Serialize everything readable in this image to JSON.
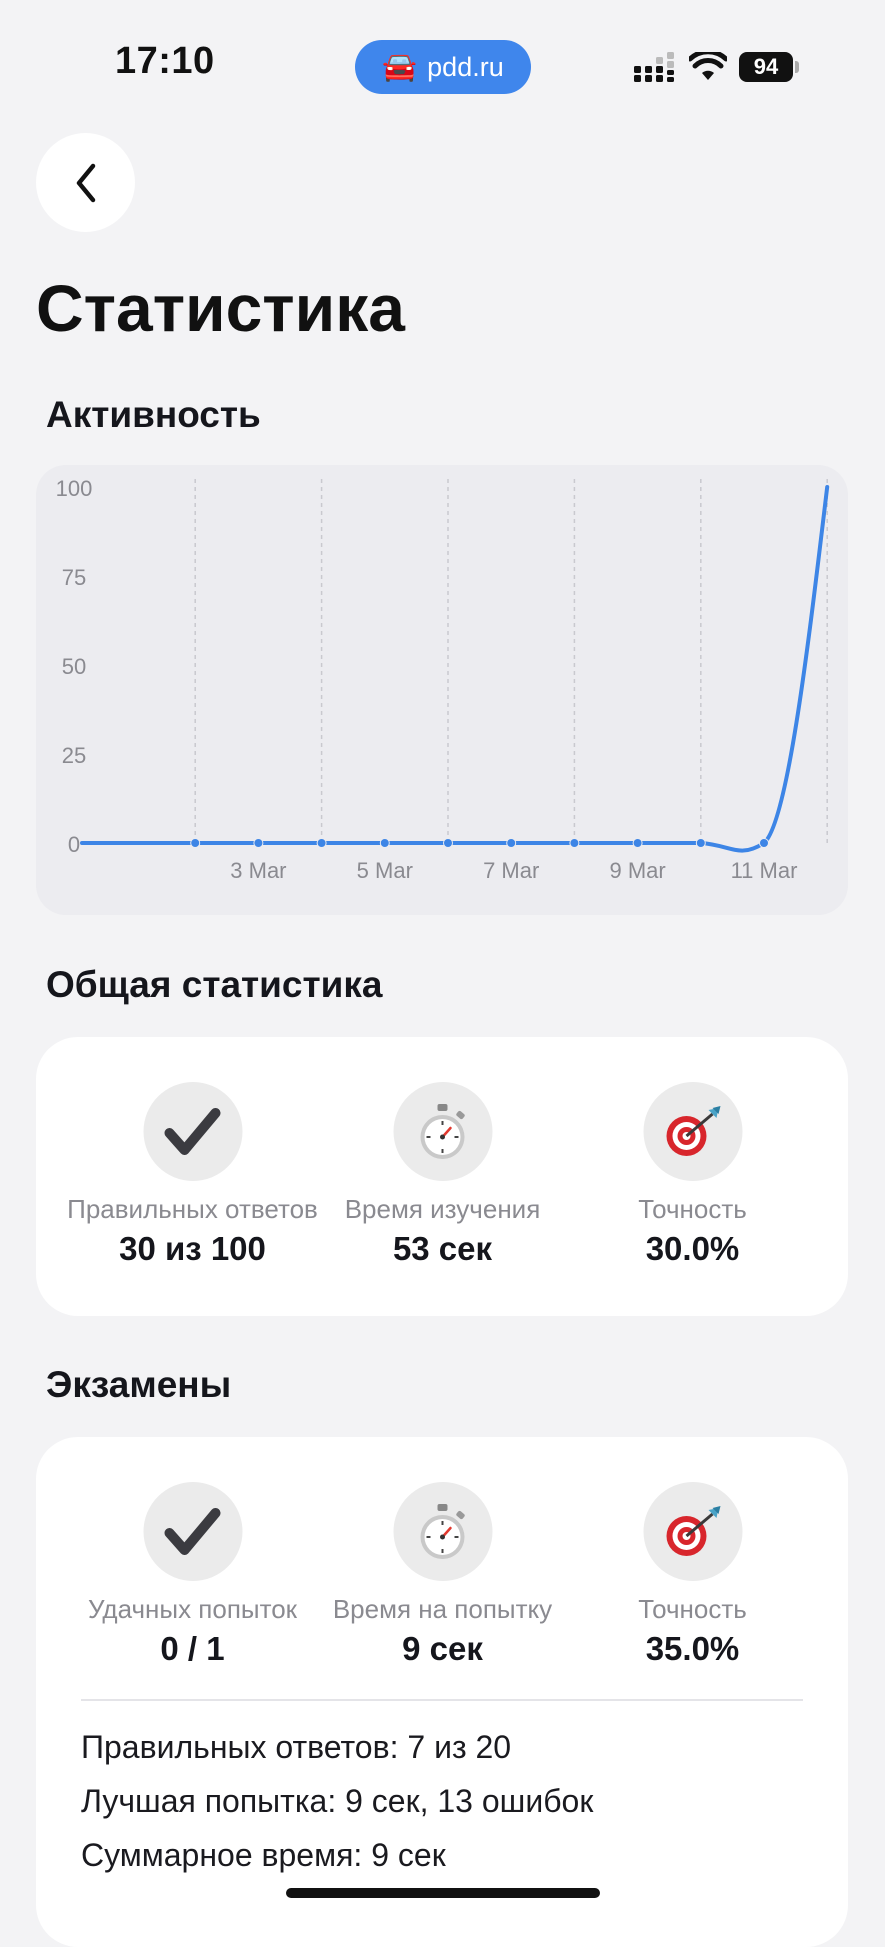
{
  "status_bar": {
    "time": "17:10",
    "url": "pdd.ru",
    "url_icon": "car-icon",
    "battery": "94"
  },
  "page": {
    "title": "Статистика"
  },
  "activity": {
    "title": "Активность",
    "chart_data": {
      "type": "line",
      "title": "",
      "xlabel": "",
      "ylabel": "",
      "y_ticks": [
        "100",
        "75",
        "50",
        "25",
        "0"
      ],
      "x_tick_labels": [
        "3 Mar",
        "5 Mar",
        "7 Mar",
        "9 Mar",
        "11 Mar"
      ],
      "ylim": [
        0,
        100
      ],
      "grid": "vertical dashed",
      "legend": "none",
      "color": "#3d85e6",
      "series": [
        {
          "x": [
            "1 Mar",
            "2 Mar",
            "3 Mar",
            "4 Mar",
            "5 Mar",
            "6 Mar",
            "7 Mar",
            "8 Mar",
            "9 Mar",
            "10 Mar",
            "11 Mar",
            "12 Mar"
          ],
          "values": [
            0,
            0,
            0,
            0,
            0,
            0,
            0,
            0,
            0,
            0,
            0,
            100
          ]
        }
      ]
    }
  },
  "general": {
    "title": "Общая статистика",
    "items": [
      {
        "icon": "checkmark-icon",
        "label": "Правильных ответов",
        "value": "30 из 100"
      },
      {
        "icon": "stopwatch-icon",
        "label": "Время изучения",
        "value": "53 сек"
      },
      {
        "icon": "target-icon",
        "label": "Точность",
        "value": "30.0%"
      }
    ]
  },
  "exams": {
    "title": "Экзамены",
    "items": [
      {
        "icon": "checkmark-icon",
        "label": "Удачных попыток",
        "value": "0 / 1"
      },
      {
        "icon": "stopwatch-icon",
        "label": "Время на попытку",
        "value": "9 сек"
      },
      {
        "icon": "target-icon",
        "label": "Точность",
        "value": "35.0%"
      }
    ],
    "details": [
      "Правильных ответов: 7 из 20",
      "Лучшая попытка: 9 сек, 13 ошибок",
      "Суммарное время: 9 сек"
    ]
  }
}
